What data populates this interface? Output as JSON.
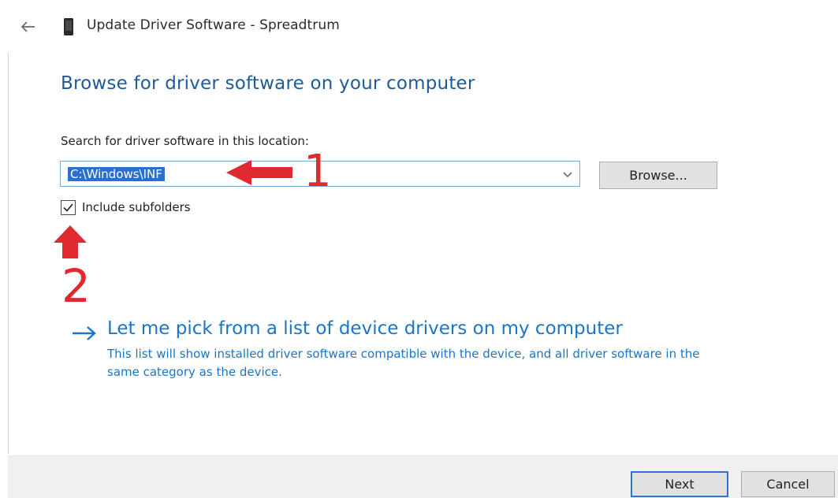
{
  "window": {
    "title": "Update Driver Software - Spreadtrum"
  },
  "page": {
    "heading": "Browse for driver software on your computer",
    "location_label": "Search for driver software in this location:",
    "location_value": "C:\\Windows\\INF",
    "browse_label": "Browse...",
    "include_subfolders_label": "Include subfolders",
    "include_subfolders_checked": true
  },
  "pick_option": {
    "title": "Let me pick from a list of device drivers on my computer",
    "description": "This list will show installed driver software compatible with the device, and all driver software in the same category as the device."
  },
  "annotations": {
    "marker_1": "1",
    "marker_2": "2",
    "color": "#e0282f"
  },
  "footer": {
    "next_label": "Next",
    "cancel_label": "Cancel"
  },
  "icons": {
    "back": "back-arrow-icon",
    "device": "device-icon",
    "dropdown": "chevron-down-icon",
    "check": "checkmark-icon",
    "link_arrow": "right-arrow-icon"
  },
  "colors": {
    "heading": "#1f5a96",
    "link": "#1a75c7",
    "selection": "#2d6fd0",
    "default_button_border": "#2f72c9"
  }
}
